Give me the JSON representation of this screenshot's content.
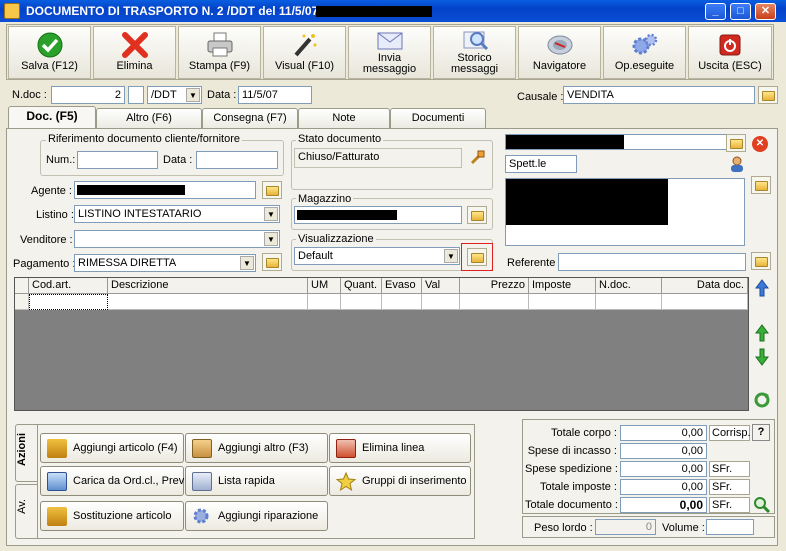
{
  "window": {
    "title": "DOCUMENTO DI TRASPORTO N. 2 /DDT del 11/5/07 -"
  },
  "toolbar": {
    "items": [
      {
        "label": "Salva (F12)",
        "icon": "check-icon",
        "color": "#2aa12a"
      },
      {
        "label": "Elimina",
        "icon": "delete-x-icon",
        "color": "#e03020"
      },
      {
        "label": "Stampa (F9)",
        "icon": "printer-icon",
        "color": "#888888"
      },
      {
        "label": "Visual (F10)",
        "icon": "magic-wand-icon",
        "color": "#333333"
      },
      {
        "label": "Invia",
        "label2": "messaggio",
        "icon": "envelope-icon",
        "color": "#6b76b8"
      },
      {
        "label": "Storico",
        "label2": "messaggi",
        "icon": "magnifier-icon",
        "color": "#5a7bc0"
      },
      {
        "label": "Navigatore",
        "icon": "compass-icon",
        "color": "#7a8aa0"
      },
      {
        "label": "Op.eseguite",
        "icon": "gears-icon",
        "color": "#5f7fd0"
      },
      {
        "label": "Uscita (ESC)",
        "icon": "power-icon",
        "color": "#d02a20"
      }
    ]
  },
  "header": {
    "ndoc_label": "N.doc :",
    "ndoc_value": "2",
    "series_value": "/DDT",
    "data_label": "Data :",
    "data_value": "11/5/07",
    "causale_label": "Causale :",
    "causale_value": "VENDITA"
  },
  "tabs": [
    {
      "label": "Doc. (F5)",
      "active": true
    },
    {
      "label": "Altro (F6)"
    },
    {
      "label": "Consegna (F7)"
    },
    {
      "label": "Note"
    },
    {
      "label": "Documenti"
    }
  ],
  "doc": {
    "rif_title": "Riferimento documento cliente/fornitore",
    "num_label": "Num.:",
    "num_value": "",
    "data_label": "Data :",
    "data_value": "",
    "agente_label": "Agente :",
    "listino_label": "Listino :",
    "listino_value": "LISTINO INTESTATARIO",
    "venditore_label": "Venditore :",
    "venditore_value": "",
    "pagamento_label": "Pagamento :",
    "pagamento_value": "RIMESSA DIRETTA",
    "stato_title": "Stato documento",
    "stato_value": "Chiuso/Fatturato",
    "magazzino_title": "Magazzino",
    "visual_title": "Visualizzazione",
    "visual_value": "Default",
    "spett_value": "Spett.le",
    "referente_label": "Referente",
    "referente_value": ""
  },
  "grid": {
    "columns": [
      "Cod.art.",
      "Descrizione",
      "UM",
      "Quant.",
      "Evaso",
      "Val",
      "Prezzo",
      "Imposte",
      "N.doc.",
      "Data doc."
    ]
  },
  "actions": {
    "vtab1": "Azioni",
    "vtab2": "Av.",
    "buttons": [
      {
        "label": "Aggiungi articolo (F4)",
        "icon": "add-article-icon"
      },
      {
        "label": "Aggiungi altro (F3)",
        "icon": "add-other-icon"
      },
      {
        "label": "Elimina linea",
        "icon": "delete-line-icon"
      },
      {
        "label": "Carica da Ord.cl., Prev",
        "icon": "load-order-icon"
      },
      {
        "label": "Lista rapida",
        "icon": "quick-list-icon"
      },
      {
        "label": "Gruppi di inserimento",
        "icon": "star-group-icon"
      },
      {
        "label": "Sostituzione articolo",
        "icon": "replace-article-icon"
      },
      {
        "label": "Aggiungi riparazione",
        "icon": "repair-icon"
      }
    ]
  },
  "totals": {
    "rows": [
      {
        "label": "Totale corpo :",
        "value": "0,00",
        "unit": "Corrisp."
      },
      {
        "label": "Spese di incasso :",
        "value": "0,00",
        "unit": ""
      },
      {
        "label": "Spese spedizione :",
        "value": "0,00",
        "unit": "SFr."
      },
      {
        "label": "Totale imposte :",
        "value": "0,00",
        "unit": "SFr."
      },
      {
        "label": "Totale documento :",
        "value": "0,00",
        "unit": "SFr."
      }
    ],
    "help": "?",
    "peso_label": "Peso lordo :",
    "peso_value": "0",
    "volume_label": "Volume :",
    "volume_value": ""
  }
}
